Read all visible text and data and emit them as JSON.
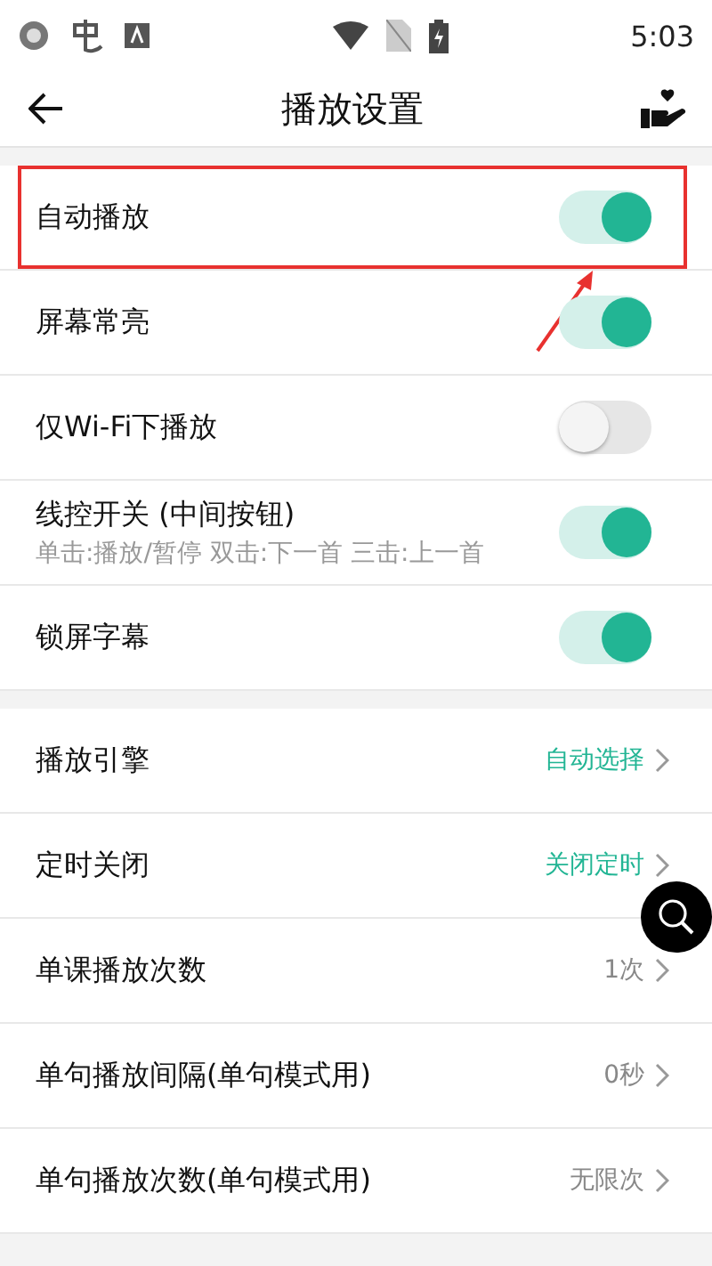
{
  "status_bar": {
    "time": "5:03"
  },
  "header": {
    "title": "播放设置"
  },
  "toggles": [
    {
      "label": "自动播放",
      "on": true,
      "highlighted": true
    },
    {
      "label": "屏幕常亮",
      "on": true,
      "highlighted": false
    },
    {
      "label": "仅Wi-Fi下播放",
      "on": false,
      "highlighted": false
    },
    {
      "label": "线控开关 (中间按钮)",
      "subtitle": "单击:播放/暂停 双击:下一首 三击:上一首",
      "on": true,
      "highlighted": false
    },
    {
      "label": "锁屏字幕",
      "on": true,
      "highlighted": false
    }
  ],
  "options": [
    {
      "label": "播放引擎",
      "value": "自动选择",
      "accent": true
    },
    {
      "label": "定时关闭",
      "value": "关闭定时",
      "accent": true
    },
    {
      "label": "单课播放次数",
      "value": "1次",
      "accent": false
    },
    {
      "label": "单句播放间隔(单句模式用)",
      "value": "0秒",
      "accent": false
    },
    {
      "label": "单句播放次数(单句模式用)",
      "value": "无限次",
      "accent": false
    }
  ]
}
